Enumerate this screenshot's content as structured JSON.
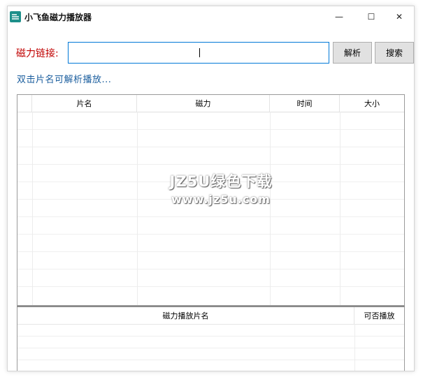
{
  "window": {
    "title": "小飞鱼磁力播放器",
    "controls": {
      "minimize": "—",
      "maximize": "☐",
      "close": "✕"
    }
  },
  "toolbar": {
    "link_label": "磁力链接:",
    "link_value": "",
    "parse_label": "解析",
    "search_label": "搜索"
  },
  "hint": "双击片名可解析播放...",
  "results_table": {
    "columns": [
      "片名",
      "磁力",
      "时间",
      "大小"
    ],
    "rows": []
  },
  "play_table": {
    "columns": [
      "磁力播放片名",
      "可否播放"
    ],
    "rows": []
  },
  "watermark": {
    "line1": "JZ5U绿色下载",
    "line2": "www.jz5u.com"
  },
  "colors": {
    "label_red": "#c00000",
    "hint_blue": "#1b5e9e",
    "input_border": "#0078d7",
    "icon_teal": "#1e8f8a"
  }
}
